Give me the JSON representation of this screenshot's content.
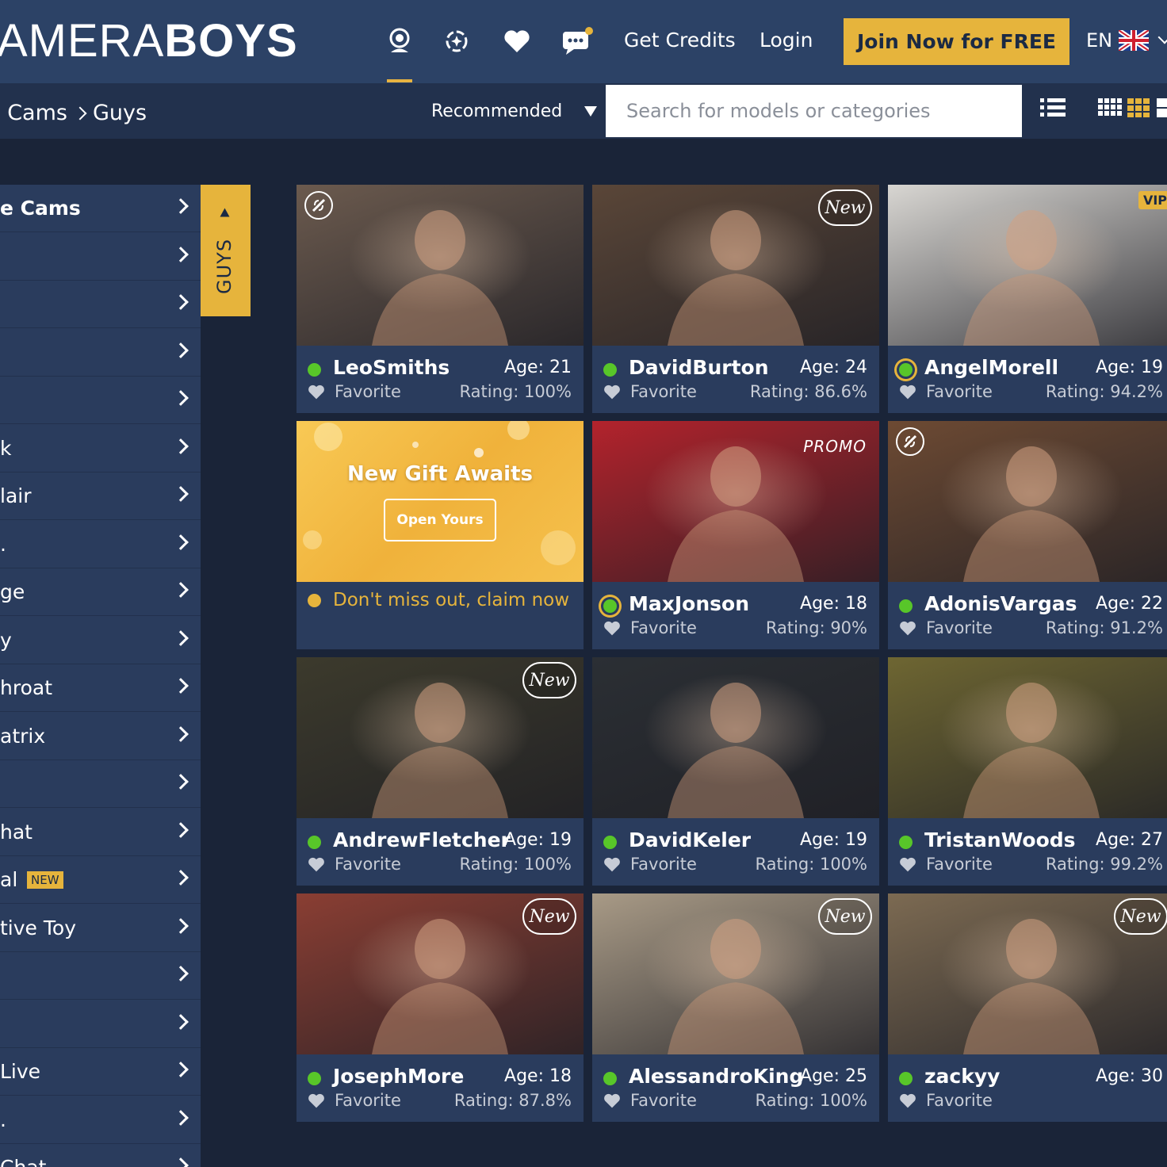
{
  "brand": {
    "logo_light": "AMERA",
    "logo_bold": "BOYS"
  },
  "header": {
    "icons": [
      "webcam-icon",
      "discover-icon",
      "heart-icon",
      "messages-icon"
    ],
    "get_credits": "Get Credits",
    "login": "Login",
    "join": "Join Now for FREE",
    "language": "EN"
  },
  "subbar": {
    "breadcrumb": [
      "e Cams",
      "Guys"
    ],
    "sort": "Recommended",
    "search_placeholder": "Search for models or categories"
  },
  "sidebar": {
    "tab_label": "GUYS",
    "items": [
      {
        "label": "e Cams",
        "bold": true
      },
      {
        "label": ""
      },
      {
        "label": ""
      },
      {
        "label": ""
      },
      {
        "label": ""
      },
      {
        "label": "k"
      },
      {
        "label": "lair"
      },
      {
        "label": "."
      },
      {
        "label": "ge"
      },
      {
        "label": "y"
      },
      {
        "label": "hroat"
      },
      {
        "label": "atrix"
      },
      {
        "label": ""
      },
      {
        "label": "hat"
      },
      {
        "label": "al",
        "badge": "NEW"
      },
      {
        "label": "tive Toy"
      },
      {
        "label": ""
      },
      {
        "label": ""
      },
      {
        "label": " Live"
      },
      {
        "label": "."
      },
      {
        "label": "Chat"
      }
    ]
  },
  "gift_card": {
    "title": "New Gift Awaits",
    "button": "Open Yours",
    "claim": "Don't miss out, claim now"
  },
  "models": [
    {
      "name": "LeoSmiths",
      "age": "Age: 21",
      "favorite": "Favorite",
      "rating": "Rating: 100%",
      "badge": "interactive",
      "status": "online",
      "bg": "#6b5a4e"
    },
    {
      "name": "DavidBurton",
      "age": "Age: 24",
      "favorite": "Favorite",
      "rating": "Rating: 86.6%",
      "badge": "New",
      "status": "online",
      "bg": "#5a4638"
    },
    {
      "name": "AngelMorell",
      "age": "Age: 19",
      "favorite": "Favorite",
      "rating": "Rating: 94.2%",
      "badge": "VIP",
      "status": "ring",
      "bg": "#d8d6d2"
    },
    {
      "name": "MaxJonson",
      "age": "Age: 18",
      "favorite": "Favorite",
      "rating": "Rating: 90%",
      "badge": "PROMO",
      "status": "ring",
      "bg": "#b3232c"
    },
    {
      "name": "AdonisVargas",
      "age": "Age: 22",
      "favorite": "Favorite",
      "rating": "Rating: 91.2%",
      "badge": "interactive",
      "status": "online",
      "bg": "#6d4a33"
    },
    {
      "name": "AndrewFletcher",
      "age": "Age: 19",
      "favorite": "Favorite",
      "rating": "Rating: 100%",
      "badge": "New",
      "status": "online",
      "bg": "#3c3a2c"
    },
    {
      "name": "DavidKeler",
      "age": "Age: 19",
      "favorite": "Favorite",
      "rating": "Rating: 100%",
      "badge": "",
      "status": "online",
      "bg": "#2b2f34"
    },
    {
      "name": "TristanWoods",
      "age": "Age: 27",
      "favorite": "Favorite",
      "rating": "Rating: 99.2%",
      "badge": "",
      "status": "online",
      "bg": "#6e6632"
    },
    {
      "name": "JosephMore",
      "age": "Age: 18",
      "favorite": "Favorite",
      "rating": "Rating: 87.8%",
      "badge": "New",
      "status": "online",
      "bg": "#8a3e33"
    },
    {
      "name": "AlessandroKing",
      "age": "Age: 25",
      "favorite": "Favorite",
      "rating": "Rating: 100%",
      "badge": "New",
      "status": "online",
      "bg": "#a89a86"
    },
    {
      "name": "zackyy",
      "age": "Age: 30",
      "favorite": "Favorite",
      "rating": "",
      "badge": "New",
      "status": "online",
      "bg": "#7c6a52"
    }
  ],
  "colors": {
    "accent": "#e6b43c",
    "header_bg": "#2c4266",
    "card_bg": "#2a3c5d",
    "online": "#58c629"
  }
}
